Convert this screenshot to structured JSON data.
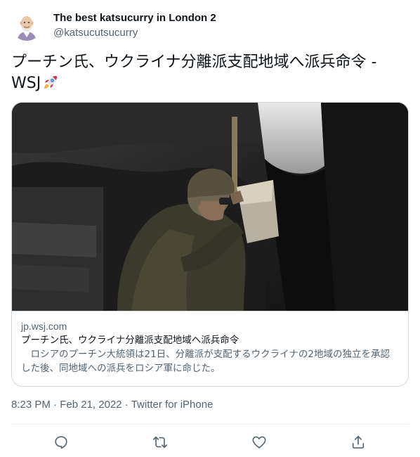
{
  "author": {
    "display_name": "The best katsucurry in London  2",
    "handle": "@katsucutsucurry",
    "avatar_icon": "bald-man-avatar"
  },
  "tweet": {
    "text": "プーチン氏、ウクライナ分離派支配地域へ派兵命令 - WSJ",
    "emoji_icon": "rocket-icon"
  },
  "card": {
    "image_description_icon": "soldier-photo",
    "domain": "jp.wsj.com",
    "title": "プーチン氏、ウクライナ分離派支配地域へ派兵命令",
    "description": "　ロシアのプーチン大統領は21日、分離派が支配するウクライナの2地域の独立を承認した後、同地域への派兵をロシア軍に命じた。"
  },
  "meta": {
    "time": "8:23 PM",
    "separator": "·",
    "date": "Feb 21, 2022",
    "source": "Twitter for iPhone"
  },
  "actions": {
    "reply_icon": "reply-icon",
    "retweet_icon": "retweet-icon",
    "like_icon": "like-icon",
    "share_icon": "share-icon"
  },
  "colors": {
    "text_primary": "#0f1419",
    "text_secondary": "#536471",
    "border": "#cfd9de"
  }
}
